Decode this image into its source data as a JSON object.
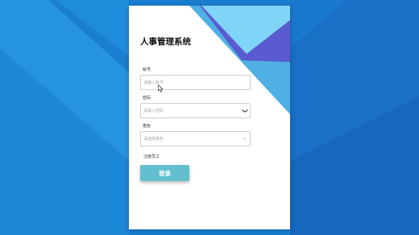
{
  "app": {
    "title": "人事管理系统"
  },
  "form": {
    "account": {
      "label": "帐号",
      "placeholder": "请输入帐号"
    },
    "password": {
      "label": "密码",
      "placeholder": "请输入密码"
    },
    "role": {
      "label": "角色",
      "placeholder": "请选择角色"
    },
    "option_text": "注册员工",
    "login_label": "登录"
  },
  "colors": {
    "background": "#1a7fd0",
    "accent_light": "#7fd4f8",
    "accent_purple": "#5a5bd0",
    "button": "#63bfcf"
  },
  "icons": {
    "password_toggle": "eye-icon",
    "role_dropdown": "chevron-down-icon",
    "pointer": "mouse-cursor-icon"
  }
}
